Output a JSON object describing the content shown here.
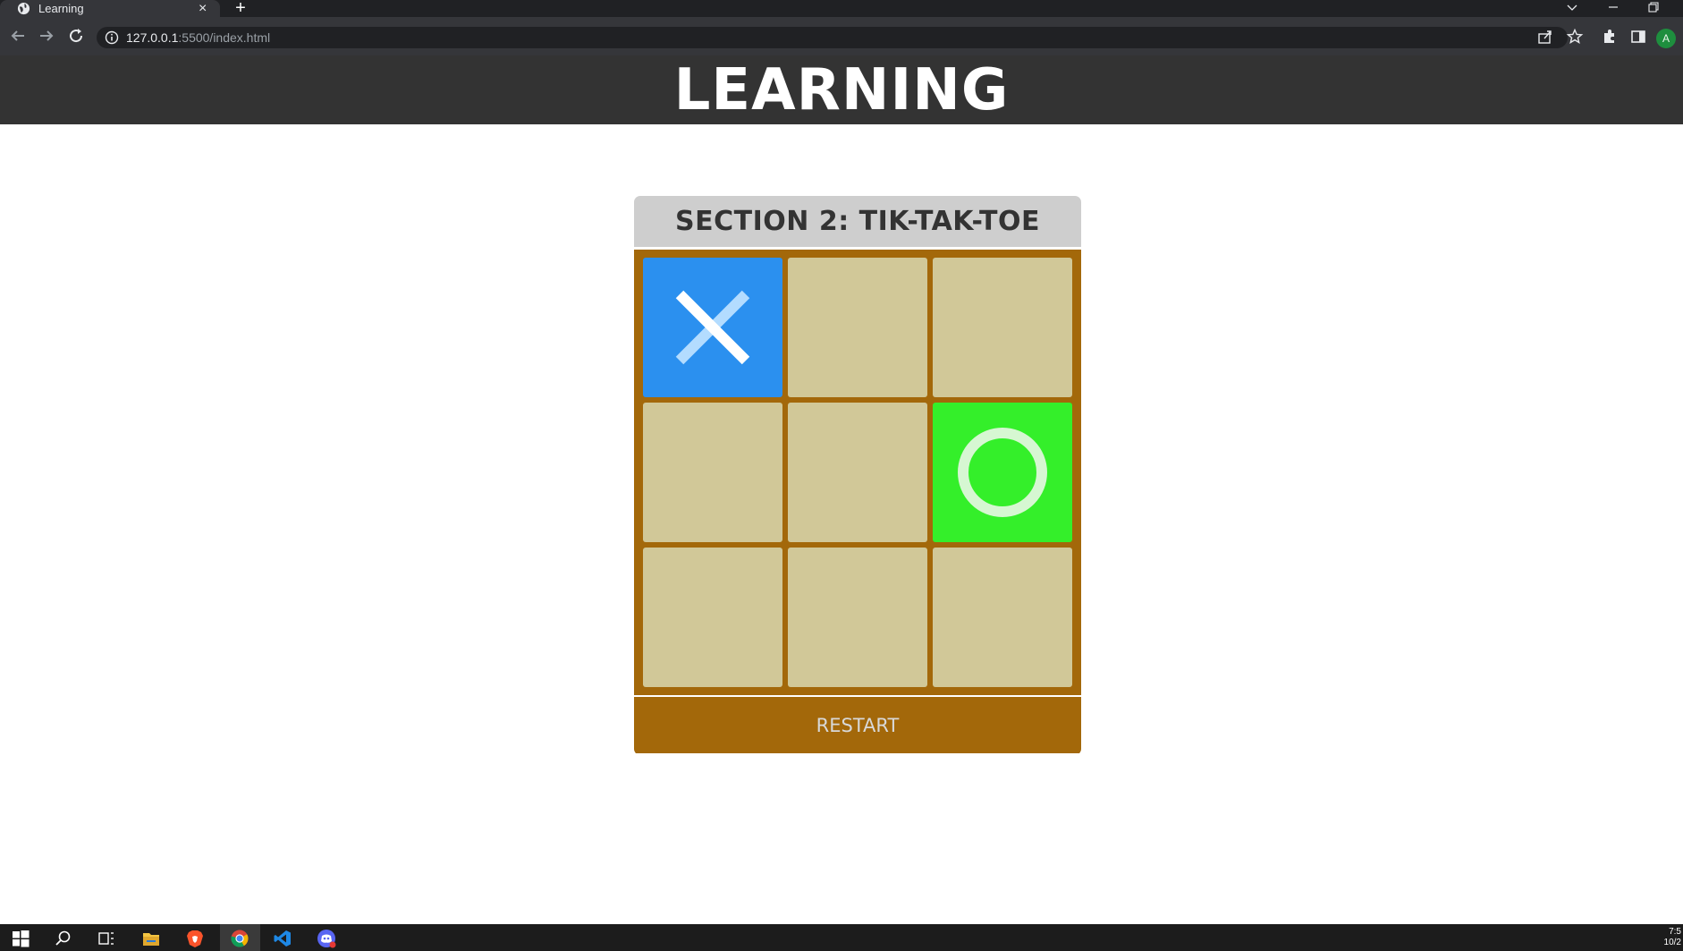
{
  "browser": {
    "tab_title": "Learning",
    "tab_close": "×",
    "new_tab": "+",
    "url_host": "127.0.0.1",
    "url_rest": ":5500/index.html",
    "profile_initial": "A"
  },
  "page": {
    "site_title": "LEARNING",
    "section_title": "SECTION 2: TIK-TAK-TOE",
    "restart_label": "RESTART",
    "board": [
      [
        "X",
        "",
        ""
      ],
      [
        "",
        "",
        "O"
      ],
      [
        "",
        "",
        ""
      ]
    ],
    "colors": {
      "header_bg": "#333333",
      "card_header_bg": "#cecece",
      "board_bg": "#a3680a",
      "empty_cell": "#d1c898",
      "x_cell": "#2b90ef",
      "o_cell": "#34ef2a"
    }
  },
  "taskbar": {
    "clock_time": "7:5",
    "clock_date": "10/2",
    "apps": [
      "windows-start-icon",
      "search-icon",
      "task-view-icon",
      "file-explorer-icon",
      "brave-icon",
      "chrome-icon",
      "vscode-icon",
      "discord-icon"
    ]
  }
}
